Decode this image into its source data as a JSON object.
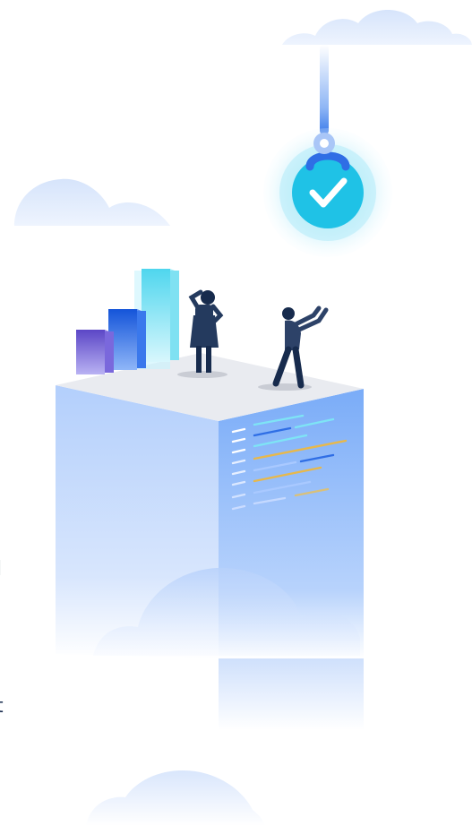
{
  "clipped_text": [
    "l",
    "rt",
    "."
  ],
  "colors": {
    "cloud": "#dfe9fb",
    "cube_top": "#e9ebf0",
    "cube_left": "#b8d3fc",
    "cube_right": "#7fb0f9",
    "check_badge": "#1fc2e6",
    "accent_line_blue": "#2f6ee5",
    "accent_line_yellow": "#e7b84c",
    "person_dark": "#172b4d"
  },
  "icons": [
    "check-badge-icon",
    "crane-hook-icon",
    "bar-chart-icon",
    "cloud-icon",
    "code-lines-icon"
  ]
}
